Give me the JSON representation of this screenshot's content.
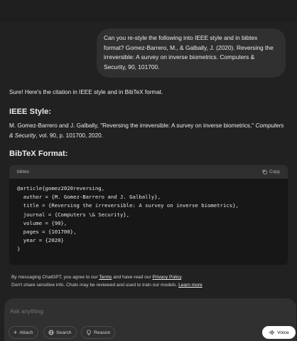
{
  "user_message": "Can you re-style the following into IEEE style and in bibtex format? Gomez-Barrero, M., & Galbally, J. (2020). Reversing the irreversible: A survey on inverse biometrics. Computers & Security, 90, 101700.",
  "assistant": {
    "intro": "Sure! Here's the citation in IEEE style and in BibTeX format.",
    "ieee_heading": "IEEE Style:",
    "ieee_text_plain": "M. Gomez-Barrero and J. Galbally, \"Reversing the irreversible: A survey on inverse biometrics,\" ",
    "ieee_journal": "Computers & Security",
    "ieee_text_tail": ", vol. 90, p. 101700, 2020.",
    "bibtex_heading": "BibTeX Format:",
    "code": {
      "language": "bibtex",
      "copy_label": "Copy",
      "content": "@article{gomez2020reversing,\n  author = {M. Gomez-Barrero and J. Galbally},\n  title = {Reversing the irreversible: A survey on inverse biometrics},\n  journal = {Computers \\& Security},\n  volume = {90},\n  pages = {101700},\n  year = {2020}\n}"
    }
  },
  "disclaimer": {
    "line1_a": "By messaging ChatGPT, you agree to our ",
    "terms": "Terms",
    "line1_b": " and have read our ",
    "privacy": "Privacy Policy",
    "line1_c": ".",
    "line2": "Don't share sensitive info. Chats may be reviewed and used to train our models. ",
    "learn_more": "Learn more"
  },
  "composer": {
    "placeholder": "Ask anything",
    "attach": "Attach",
    "search": "Search",
    "reason": "Reason",
    "voice": "Voice"
  }
}
